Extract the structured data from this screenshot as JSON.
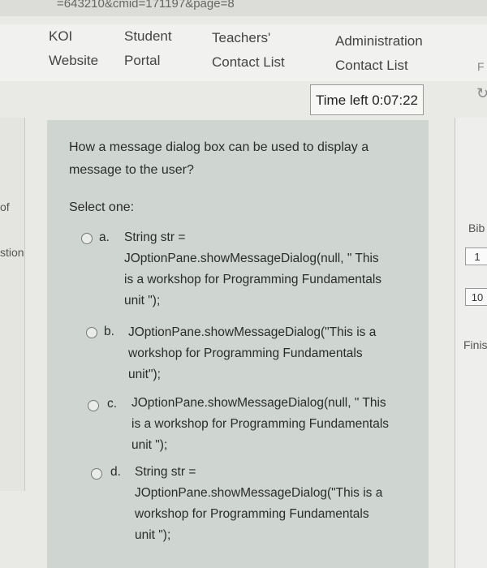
{
  "browser": {
    "url_fragment": "=643210&cmid=171197&page=8"
  },
  "nav": {
    "links": [
      {
        "lines": [
          "KOI",
          "Website"
        ]
      },
      {
        "lines": [
          "Student",
          "Portal"
        ]
      },
      {
        "lines": [
          "Teachers'",
          "Contact List"
        ]
      },
      {
        "lines": [
          "Administration",
          "Contact List"
        ]
      }
    ]
  },
  "timer": {
    "label": "Time left 0:07:22"
  },
  "left_sidebar": {
    "fragment1": "of",
    "fragment2": "stion"
  },
  "right_panel": {
    "fragment1": "Bib",
    "btn1": "1",
    "btn2": "10",
    "fragment2": "Finis",
    "top_char": "F"
  },
  "question": {
    "lines": [
      "How a message dialog box can be used to display a",
      "message to the user?"
    ],
    "select_one": "Select one:",
    "options": [
      {
        "letter": "a.",
        "lines": [
          "String str =",
          "JOptionPane.showMessageDialog(null, \" This",
          "is a workshop for Programming Fundamentals",
          "unit \");"
        ]
      },
      {
        "letter": "b.",
        "lines": [
          "JOptionPane.showMessageDialog(\"This is a",
          "workshop for Programming Fundamentals",
          "unit\");"
        ]
      },
      {
        "letter": "c.",
        "lines": [
          "JOptionPane.showMessageDialog(null, \" This",
          "is a workshop for Programming Fundamentals",
          "unit \");"
        ]
      },
      {
        "letter": "d.",
        "lines": [
          "String str =",
          "JOptionPane.showMessageDialog(\"This is a",
          "workshop for Programming Fundamentals",
          "unit \");"
        ]
      }
    ]
  }
}
